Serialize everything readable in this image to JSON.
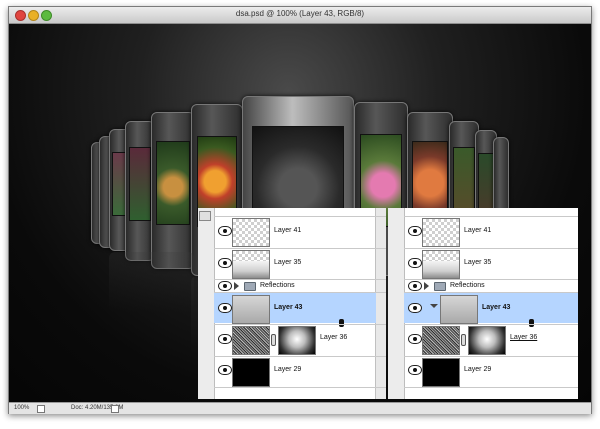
{
  "window": {
    "title": "dsa.psd @ 100% (Layer 43, RGB/8)"
  },
  "statusbar": {
    "zoom": "100%",
    "doc_info": "Doc: 4.20M/135.8M"
  },
  "layers_panels": [
    {
      "layers": [
        {
          "name": "Layer 41",
          "thumb": "transparent"
        },
        {
          "name": "Layer 35",
          "thumb": "gradient"
        },
        {
          "name": "Reflections",
          "thumb": "folder"
        },
        {
          "name": "Layer 43",
          "thumb": "gray",
          "selected": true
        },
        {
          "name": "Layer 36",
          "thumb": "noise+mask"
        },
        {
          "name": "Layer 29",
          "thumb": "black"
        }
      ]
    },
    {
      "layers": [
        {
          "name": "Layer 41",
          "thumb": "transparent"
        },
        {
          "name": "Layer 35",
          "thumb": "gradient"
        },
        {
          "name": "Reflections",
          "thumb": "folder"
        },
        {
          "name": "Layer 43",
          "thumb": "gray",
          "selected": true,
          "clipped": true
        },
        {
          "name": "Layer 36",
          "thumb": "noise+mask"
        },
        {
          "name": "Layer 29",
          "thumb": "black"
        }
      ]
    }
  ],
  "colors": {
    "selected_row": "#b5d5ff",
    "canvas_bg": "#0c0c0c",
    "panel_bg": "#ffffff"
  }
}
